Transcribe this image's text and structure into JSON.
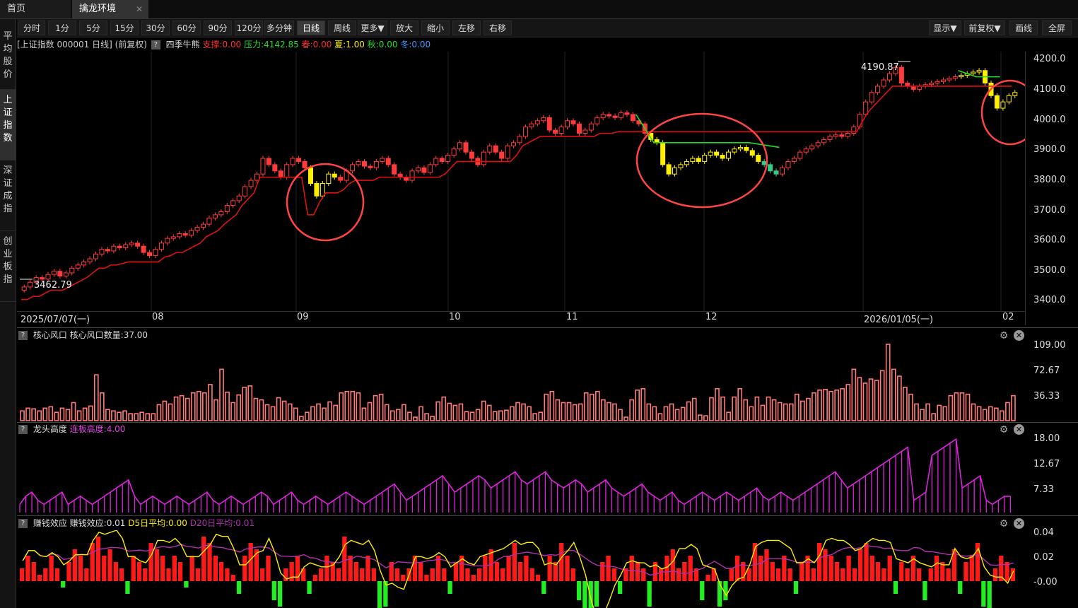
{
  "tabs": {
    "home": "首页",
    "active": "擒龙环境",
    "close": "✕"
  },
  "toolbar": {
    "periods": [
      "分时",
      "1分",
      "5分",
      "15分",
      "30分",
      "60分",
      "90分",
      "120分",
      "多分钟",
      "日线",
      "周线",
      "更多▼",
      "放大",
      "缩小",
      "左移",
      "右移"
    ],
    "selected": "日线",
    "right": [
      "显示▼",
      "前复权▼",
      "画线",
      "全屏"
    ]
  },
  "sidebar": [
    "平均股价",
    "上证指数",
    "深证成指",
    "创业板指"
  ],
  "sidebar_selected": "上证指数",
  "main_chart": {
    "title": "[上证指数 000001 日线] (前复权)",
    "indicator": "四季牛熊",
    "support": "支撑:0.00",
    "pressure": "压力:4142.85",
    "spring": "春:0.00",
    "summer": "夏:1.00",
    "autumn": "秋:0.00",
    "winter": "冬:0.00",
    "high_label": "4190.87",
    "low_label": "3462.79",
    "y_ticks": [
      "4200.0",
      "4100.0",
      "4000.0",
      "3900.0",
      "3800.0",
      "3700.0",
      "3600.0",
      "3500.0",
      "3400.0"
    ],
    "dates": [
      "2025/07/07(一)",
      "08",
      "09",
      "10",
      "11",
      "12",
      "2026/01/05(一)",
      "02"
    ],
    "colors": {
      "up": "#ff3b3b",
      "down": "#ff3b3b",
      "yellow": "#ffee00",
      "support": "#e01010",
      "pressure": "#22dd22",
      "circle": "#ff4444"
    }
  },
  "panel1": {
    "title": "核心风口",
    "value": "核心风口数量:37.00",
    "y_ticks": [
      "109.00",
      "72.67",
      "36.33"
    ]
  },
  "panel2": {
    "title": "龙头高度",
    "value": "连板高度:4.00",
    "y_ticks": [
      "18.00",
      "12.67",
      "7.33"
    ]
  },
  "panel3": {
    "title": "赚钱效应",
    "value": "赚钱效应:0.01",
    "d5": "D5日平均:0.00",
    "d20": "D20日平均:0.01",
    "y_ticks": [
      "0.04",
      "0.02",
      "-0.00"
    ]
  },
  "chart_data": {
    "type": "candlestick",
    "index": "上证指数 000001",
    "high": 4190.87,
    "low": 3462.79,
    "ylim": [
      3400,
      4200
    ],
    "x_labels": [
      "2025/07/07(一)",
      "08",
      "09",
      "10",
      "11",
      "12",
      "2026/01/05(一)",
      "02"
    ],
    "close": [
      3470,
      3485,
      3500,
      3495,
      3510,
      3520,
      3505,
      3515,
      3530,
      3540,
      3550,
      3560,
      3575,
      3590,
      3585,
      3600,
      3595,
      3605,
      3610,
      3600,
      3580,
      3570,
      3590,
      3610,
      3625,
      3630,
      3640,
      3635,
      3650,
      3660,
      3670,
      3690,
      3700,
      3710,
      3730,
      3745,
      3760,
      3790,
      3810,
      3830,
      3880,
      3860,
      3840,
      3820,
      3860,
      3880,
      3870,
      3850,
      3800,
      3760,
      3800,
      3830,
      3820,
      3810,
      3840,
      3860,
      3870,
      3855,
      3850,
      3870,
      3880,
      3860,
      3830,
      3820,
      3810,
      3840,
      3850,
      3835,
      3860,
      3880,
      3870,
      3890,
      3910,
      3930,
      3900,
      3880,
      3860,
      3900,
      3920,
      3900,
      3880,
      3920,
      3930,
      3950,
      3980,
      3990,
      4000,
      4010,
      3970,
      3960,
      3980,
      4000,
      3990,
      3960,
      3970,
      3990,
      4010,
      4020,
      4015,
      4010,
      4025,
      4020,
      4000,
      3990,
      3960,
      3940,
      3930,
      3860,
      3830,
      3850,
      3860,
      3870,
      3880,
      3870,
      3890,
      3900,
      3890,
      3880,
      3900,
      3910,
      3915,
      3905,
      3890,
      3870,
      3860,
      3840,
      3830,
      3850,
      3870,
      3880,
      3900,
      3910,
      3920,
      3930,
      3940,
      3950,
      3955,
      3950,
      3960,
      3980,
      4020,
      4060,
      4090,
      4110,
      4130,
      4150,
      4170,
      4120,
      4110,
      4100,
      4110,
      4115,
      4120,
      4125,
      4130,
      4135,
      4140,
      4145,
      4150,
      4155,
      4160,
      4120,
      4080,
      4040,
      4060,
      4080,
      4090
    ],
    "volume_core_window": [
      14,
      18,
      17,
      14,
      18,
      20,
      12,
      18,
      16,
      26,
      14,
      18,
      21,
      66,
      40,
      16,
      14,
      12,
      14,
      10,
      10,
      12,
      10,
      10,
      23,
      28,
      24,
      34,
      36,
      32,
      40,
      42,
      40,
      52,
      30,
      74,
      41,
      26,
      37,
      48,
      50,
      32,
      30,
      23,
      20,
      33,
      28,
      24,
      18,
      6,
      12,
      20,
      24,
      18,
      27,
      22,
      40,
      42,
      42,
      40,
      18,
      26,
      36,
      38,
      23,
      14,
      16,
      23,
      12,
      5,
      20,
      10,
      6,
      27,
      34,
      25,
      22,
      24,
      13,
      12,
      16,
      28,
      22,
      13,
      14,
      15,
      20,
      26,
      24,
      20,
      10,
      12,
      38,
      42,
      30,
      26,
      26,
      23,
      24,
      40,
      38,
      42,
      30,
      26,
      24,
      16,
      5,
      30,
      44,
      46,
      24,
      20,
      10,
      20,
      24,
      16,
      19,
      27,
      32,
      8,
      7,
      33,
      46,
      34,
      12,
      34,
      46,
      30,
      20,
      34,
      22,
      34,
      30,
      26,
      24,
      24,
      38,
      28,
      32,
      40,
      44,
      45,
      42,
      44,
      46,
      52,
      74,
      62,
      54,
      60,
      58,
      72,
      110,
      74,
      64,
      48,
      38,
      24,
      16,
      24,
      10,
      22,
      20,
      36,
      40,
      40,
      38,
      24,
      20,
      16,
      20,
      18,
      14,
      26,
      36
    ],
    "board_height": [
      2,
      4,
      5,
      3,
      2,
      3,
      4,
      5,
      2,
      3,
      4,
      3,
      2,
      3,
      4,
      5,
      6,
      7,
      8,
      4,
      2,
      3,
      4,
      3,
      2,
      3,
      4,
      3,
      2,
      3,
      4,
      5,
      3,
      2,
      3,
      4,
      3,
      2,
      3,
      4,
      5,
      4,
      2,
      3,
      4,
      5,
      3,
      2,
      3,
      4,
      3,
      2,
      3,
      4,
      5,
      4,
      3,
      2,
      3,
      4,
      5,
      6,
      7,
      5,
      3,
      4,
      5,
      6,
      7,
      8,
      9,
      7,
      5,
      6,
      7,
      8,
      9,
      8,
      6,
      7,
      8,
      9,
      10,
      8,
      7,
      8,
      9,
      10,
      8,
      7,
      6,
      7,
      8,
      7,
      5,
      6,
      7,
      8,
      6,
      5,
      4,
      5,
      6,
      7,
      5,
      4,
      3,
      4,
      5,
      3,
      2,
      3,
      4,
      5,
      4,
      3,
      4,
      5,
      4,
      3,
      4,
      5,
      6,
      4,
      3,
      4,
      5,
      4,
      3,
      4,
      5,
      6,
      7,
      8,
      9,
      10,
      8,
      6,
      7,
      8,
      9,
      10,
      11,
      12,
      13,
      14,
      15,
      16,
      3,
      4,
      5,
      14,
      15,
      16,
      17,
      18,
      6,
      7,
      8,
      9,
      3,
      2,
      3,
      4,
      4
    ],
    "money_effect": [
      0.01,
      0.02,
      0.015,
      0.005,
      0.01,
      0.02,
      0.01,
      -0.005,
      0.015,
      0.025,
      0.02,
      0.01,
      0.03,
      0.035,
      0.02,
      0.025,
      0.015,
      0.01,
      -0.01,
      0.02,
      0.015,
      0.01,
      0.03,
      0.025,
      0.02,
      0.01,
      0.02,
      0.015,
      -0.005,
      0.02,
      0.01,
      0.035,
      0.03,
      0.02,
      0.015,
      0.01,
      0.005,
      -0.01,
      0.02,
      0.03,
      0.025,
      0.01,
      0.02,
      -0.015,
      -0.02,
      0.01,
      0.015,
      0.02,
      0.01,
      -0.01,
      0.005,
      0.01,
      0.02,
      0.015,
      0.01,
      0.035,
      0.02,
      0.015,
      0.01,
      0.02,
      0.01,
      -0.03,
      -0.02,
      0.015,
      0.01,
      0.005,
      0.01,
      0.02,
      0.015,
      0.005,
      0.01,
      0.02,
      0.01,
      -0.01,
      0.015,
      0.02,
      0.01,
      0.005,
      0.01,
      0.02,
      0.025,
      0.015,
      0.01,
      0.02,
      0.03,
      0.015,
      0.02,
      0.01,
      0.005,
      -0.01,
      0.02,
      0.015,
      0.03,
      0.02,
      0.01,
      -0.015,
      -0.03,
      -0.035,
      -0.02,
      0.015,
      0.02,
      0.01,
      -0.01,
      0.01,
      0.02,
      0.015,
      0.01,
      -0.02,
      0.015,
      0.01,
      0.02,
      0.025,
      0.01,
      0.015,
      0.02,
      0.01,
      -0.015,
      0.005,
      0.01,
      -0.02,
      -0.015,
      0.01,
      0.02,
      0.015,
      0.01,
      0.03,
      0.02,
      0.025,
      0.015,
      0.01,
      0.02,
      0.01,
      -0.01,
      0.015,
      0.02,
      0.01,
      0.03,
      0.025,
      0.02,
      0.015,
      0.01,
      0.02,
      0.01,
      0.025,
      0.03,
      0.02,
      0.015,
      0.01,
      0.02,
      -0.01,
      0.015,
      0.01,
      0.02,
      0.01,
      -0.015,
      0.01,
      0.02,
      0.015,
      0.01,
      0.025,
      -0.01,
      0.015,
      0.02,
      0.03,
      -0.02,
      -0.03,
      0.01,
      0.02,
      0.015,
      0.01
    ]
  }
}
